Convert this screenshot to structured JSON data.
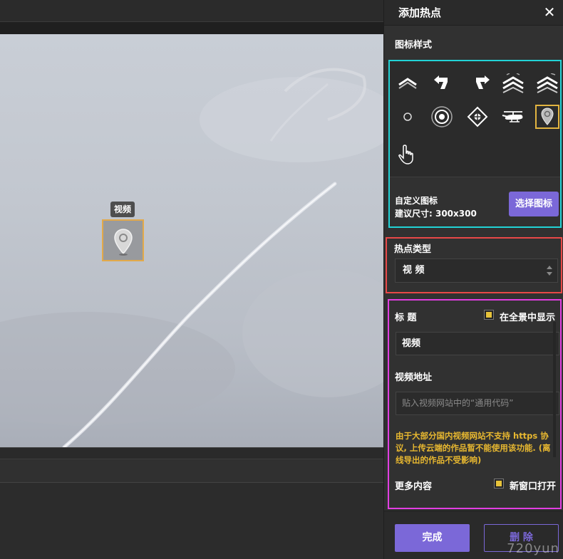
{
  "viewer": {
    "hotspot_tooltip": "视频"
  },
  "panel": {
    "title": "添加热点",
    "close_icon": "close-icon",
    "icon_style_label": "图标样式",
    "icons": [
      {
        "name": "double-chevron-up-icon"
      },
      {
        "name": "arrow-turn-left-icon"
      },
      {
        "name": "arrow-turn-right-icon"
      },
      {
        "name": "triple-chevron-up-icon"
      },
      {
        "name": "triple-chevron-up-alt-icon"
      },
      {
        "name": "small-circle-icon"
      },
      {
        "name": "concentric-circle-icon"
      },
      {
        "name": "diamond-target-icon"
      },
      {
        "name": "helicopter-icon"
      },
      {
        "name": "map-pin-icon",
        "selected": true
      },
      {
        "name": "hand-pointer-icon"
      }
    ],
    "custom_icon_label": "自定义图标",
    "custom_icon_size": "建议尺寸: 300x300",
    "choose_icon_button": "选择图标",
    "hotspot_type_label": "热点类型",
    "hotspot_type_value": "视 频",
    "title_label": "标 题",
    "show_in_panorama_label": "在全景中显示",
    "title_value": "视频",
    "video_url_label": "视频地址",
    "video_url_placeholder": "贴入视频网站中的“通用代码”",
    "warning_text": "由于大部分国内视频网站不支持 https 协议, 上传云端的作品暂不能使用该功能. (离线导出的作品不受影响)",
    "more_content_label": "更多内容",
    "new_window_label": "新窗口打开",
    "done_button": "完成",
    "delete_button": "删 除",
    "watermark": "720yun"
  },
  "colors": {
    "accent": "#7b68d8",
    "icon_box_border": "#22d3d6",
    "type_box_border": "#e84848",
    "detail_box_border": "#e23ee2",
    "selected_icon_border": "#e2b440",
    "warning_text": "#e8b830"
  }
}
